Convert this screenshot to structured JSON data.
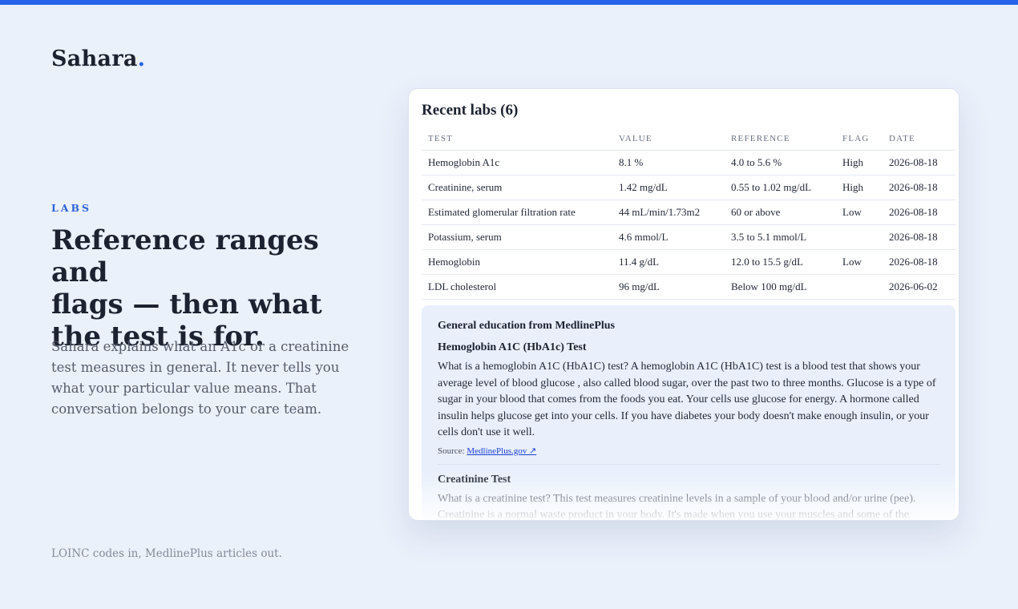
{
  "brand": {
    "name": "Sahara",
    "dot": "."
  },
  "hero": {
    "eyebrow": "LABS",
    "headline_lines": [
      "Reference ranges and",
      "flags — then what",
      "the test is for."
    ],
    "lede": "Sahara explains what an A1c or a creatinine test measures in general. It never tells you what your particular value means. That conversation belongs to your care team.",
    "footnote": "LOINC codes in, MedlinePlus articles out."
  },
  "card": {
    "title": "Recent labs (6)",
    "columns": [
      "TEST",
      "VALUE",
      "REFERENCE",
      "FLAG",
      "DATE"
    ],
    "rows": [
      [
        "Hemoglobin A1c",
        "8.1 %",
        "4.0 to 5.6 %",
        "High",
        "2026-08-18"
      ],
      [
        "Creatinine, serum",
        "1.42 mg/dL",
        "0.55 to 1.02 mg/dL",
        "High",
        "2026-08-18"
      ],
      [
        "Estimated glomerular filtration rate",
        "44 mL/min/1.73m2",
        "60 or above",
        "Low",
        "2026-08-18"
      ],
      [
        "Potassium, serum",
        "4.6 mmol/L",
        "3.5 to 5.1 mmol/L",
        "",
        "2026-08-18"
      ],
      [
        "Hemoglobin",
        "11.4 g/dL",
        "12.0 to 15.5 g/dL",
        "Low",
        "2026-08-18"
      ],
      [
        "LDL cholesterol",
        "96 mg/dL",
        "Below 100 mg/dL",
        "",
        "2026-06-02"
      ]
    ],
    "education": {
      "heading": "General education from MedlinePlus",
      "articles": [
        {
          "title": "Hemoglobin A1C (HbA1c) Test",
          "body": "What is a hemoglobin A1C (HbA1C) test? A hemoglobin A1C (HbA1C) test is a blood test that shows your average level of blood glucose , also called blood sugar, over the past two to three months. Glucose is a type of sugar in your blood that comes from the foods you eat. Your cells use glucose for energy. A hormone called insulin helps glucose get into your cells. If you have diabetes your body doesn't make enough insulin, or your cells don't use it well.",
          "source_label": "Source:",
          "source_link": "MedlinePlus.gov ↗"
        },
        {
          "title": "Creatinine Test",
          "body": "What is a creatinine test? This test measures creatinine levels in a sample of your blood and/or urine (pee). Creatinine is a normal waste product in your body. It's made when you use your muscles and some of the muscle tissue breaks down. Normally, your kidneys filter creatinine from your blood and remove it from your body in your urine. If there is a problem"
        }
      ]
    }
  },
  "colors": {
    "accent": "#2563eb",
    "background": "#ebf1fb",
    "edu_panel": "#e9f0fc"
  }
}
